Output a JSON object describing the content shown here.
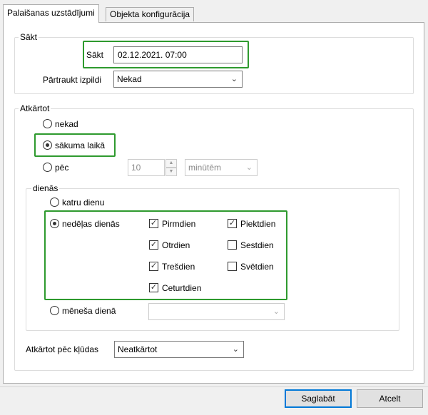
{
  "tabs": [
    {
      "label": "Palaišanas uzstādījumi",
      "active": true
    },
    {
      "label": "Objekta konfigurācija",
      "active": false
    }
  ],
  "start_group": {
    "title": "Sākt",
    "start_label": "Sākt",
    "start_value": "02.12.2021. 07:00",
    "stop_label": "Pārtraukt izpildi",
    "stop_value": "Nekad"
  },
  "repeat_group": {
    "title": "Atkārtot",
    "options": {
      "never": "nekad",
      "at_start": "sākuma laikā",
      "after": "pēc"
    },
    "selected": "at_start",
    "after_value": "10",
    "after_unit": "minūtēm",
    "days_group": {
      "title": "dienās",
      "every_day": "katru dienu",
      "weekdays": "nedēļas dienās",
      "month_day": "mēneša dienā",
      "selected": "weekdays",
      "days": [
        {
          "label": "Pirmdien",
          "checked": true
        },
        {
          "label": "Otrdien",
          "checked": true
        },
        {
          "label": "Trešdien",
          "checked": true
        },
        {
          "label": "Ceturtdien",
          "checked": true
        },
        {
          "label": "Piektdien",
          "checked": true
        },
        {
          "label": "Sestdien",
          "checked": false
        },
        {
          "label": "Svētdien",
          "checked": false
        }
      ],
      "month_day_value": ""
    },
    "error_label": "Atkārtot pēc kļūdas",
    "error_value": "Neatkārtot"
  },
  "buttons": {
    "save": "Saglabāt",
    "cancel": "Atcelt"
  },
  "colors": {
    "highlight": "#2e9a2e",
    "primary_border": "#0078d7"
  },
  "icons": {
    "dropdown": "chevron-down-icon",
    "check": "checkmark-icon"
  }
}
